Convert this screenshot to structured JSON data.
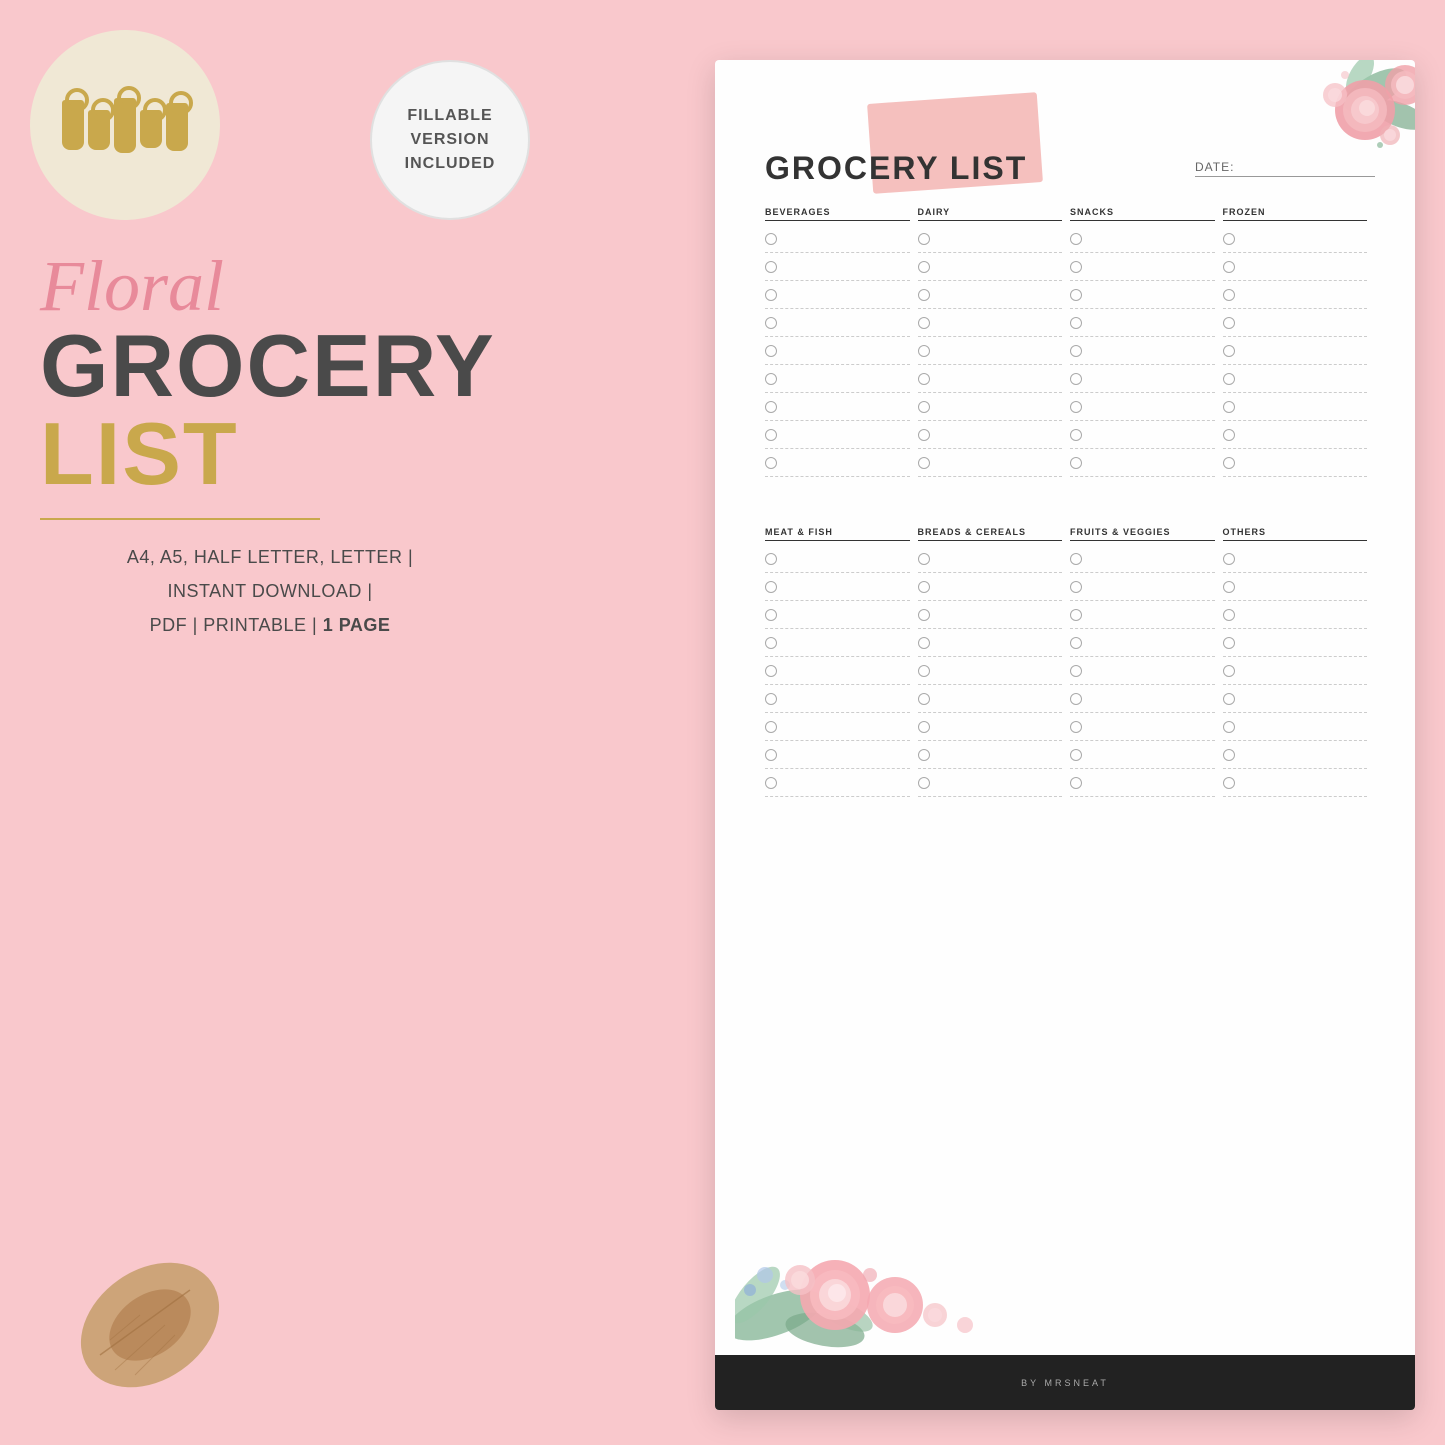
{
  "page": {
    "background_color": "#f9c8cc"
  },
  "badge": {
    "line1": "FILLABLE",
    "line2": "VERSION",
    "line3": "INCLUDED"
  },
  "left_panel": {
    "script_title": "Floral",
    "bold_line1": "GROCERY",
    "gold_line": "LIST",
    "subtitle_lines": [
      "A4, A5, HALF LETTER, LETTER |",
      "INSTANT DOWNLOAD |",
      "PDF | PRINTABLE | 1 PAGE"
    ],
    "bold_word": "1 PAGE"
  },
  "document": {
    "title": "GROCERY LIST",
    "date_label": "DATE:",
    "footer_text": "BY MRSNEAT",
    "sections_top": [
      {
        "id": "beverages",
        "header": "BEVERAGES",
        "rows": 9
      },
      {
        "id": "dairy",
        "header": "DAIRY",
        "rows": 9
      },
      {
        "id": "snacks",
        "header": "SNACKS",
        "rows": 9
      },
      {
        "id": "frozen",
        "header": "FROZEN",
        "rows": 9
      }
    ],
    "sections_bottom": [
      {
        "id": "meat-fish",
        "header": "MEAT & FISH",
        "rows": 9
      },
      {
        "id": "breads-cereals",
        "header": "BREADS & CEREALS",
        "rows": 9
      },
      {
        "id": "fruits-veggies",
        "header": "FRUITS & VEGGIES",
        "rows": 9
      },
      {
        "id": "others",
        "header": "OTHERS",
        "rows": 9
      }
    ]
  },
  "colors": {
    "pink_accent": "#e88a9a",
    "gold_accent": "#c9a84c",
    "dark_text": "#4a4a4a",
    "light_pink_bg": "#f9c8cc",
    "doc_bg": "#fefefe"
  }
}
